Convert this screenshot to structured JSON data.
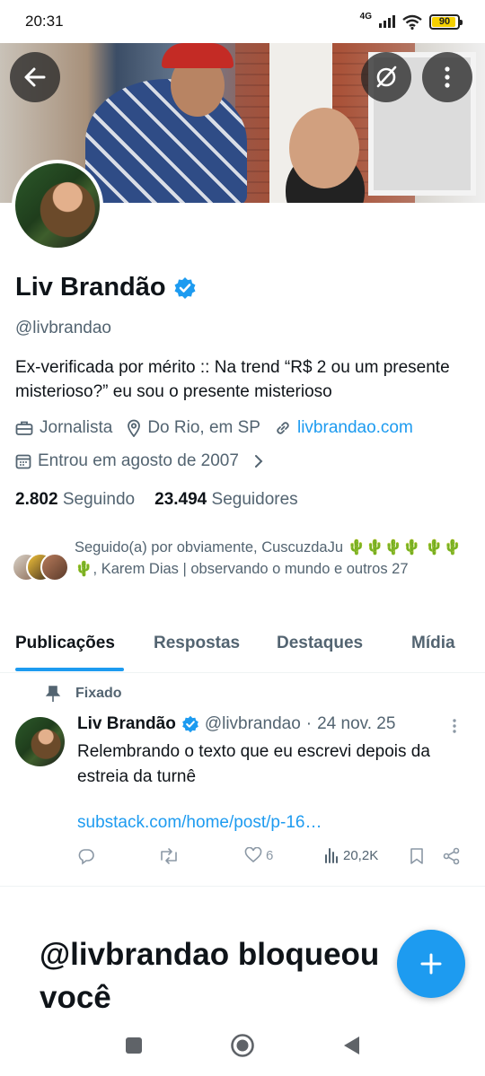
{
  "status_bar": {
    "time": "20:31",
    "network": "4G",
    "battery": "90"
  },
  "header": {
    "back_icon": "arrow-left-icon",
    "grok_icon": "grok-slash-icon",
    "more_icon": "more-vertical-icon"
  },
  "profile": {
    "name": "Liv Brandão",
    "handle": "@livbrandao",
    "verified_color": "#1d9bf0",
    "bio": "Ex-verificada por mérito :: Na trend “R$ 2 ou um presente misterioso?” eu sou o presente misterioso",
    "profession": "Jornalista",
    "location": "Do Rio, em SP",
    "website": "livbrandao.com",
    "joined": "Entrou em agosto de 2007",
    "following_count": "2.802",
    "following_label": "Seguindo",
    "followers_count": "23.494",
    "followers_label": "Seguidores",
    "followed_by_prefix": "Seguido(a) por obviamente, CuscuzdaJu",
    "followed_by_middle": ", Karem Dias | observando o mundo e outros 27"
  },
  "tabs": [
    {
      "label": "Publicações",
      "active": true
    },
    {
      "label": "Respostas",
      "active": false
    },
    {
      "label": "Destaques",
      "active": false
    },
    {
      "label": "Mídia",
      "active": false
    }
  ],
  "tweet": {
    "pinned_label": "Fixado",
    "author": "Liv Brandão",
    "handle": "@livbrandao",
    "separator": "·",
    "date": "24 nov. 25",
    "text": "Relembrando o texto que eu escrevi depois da estreia da turnê",
    "link": "substack.com/home/post/p-16…",
    "likes": "6",
    "views": "20,2K"
  },
  "blocked_message": "@livbrandao bloqueou você",
  "fab": {
    "icon": "plus-icon",
    "color": "#1d9bf0"
  },
  "nav": {
    "recent_icon": "square-icon",
    "home_icon": "circle-home-icon",
    "back_icon": "triangle-back-icon"
  },
  "colors": {
    "accent": "#1d9bf0",
    "text_secondary": "#536471",
    "text_primary": "#0f1419"
  }
}
